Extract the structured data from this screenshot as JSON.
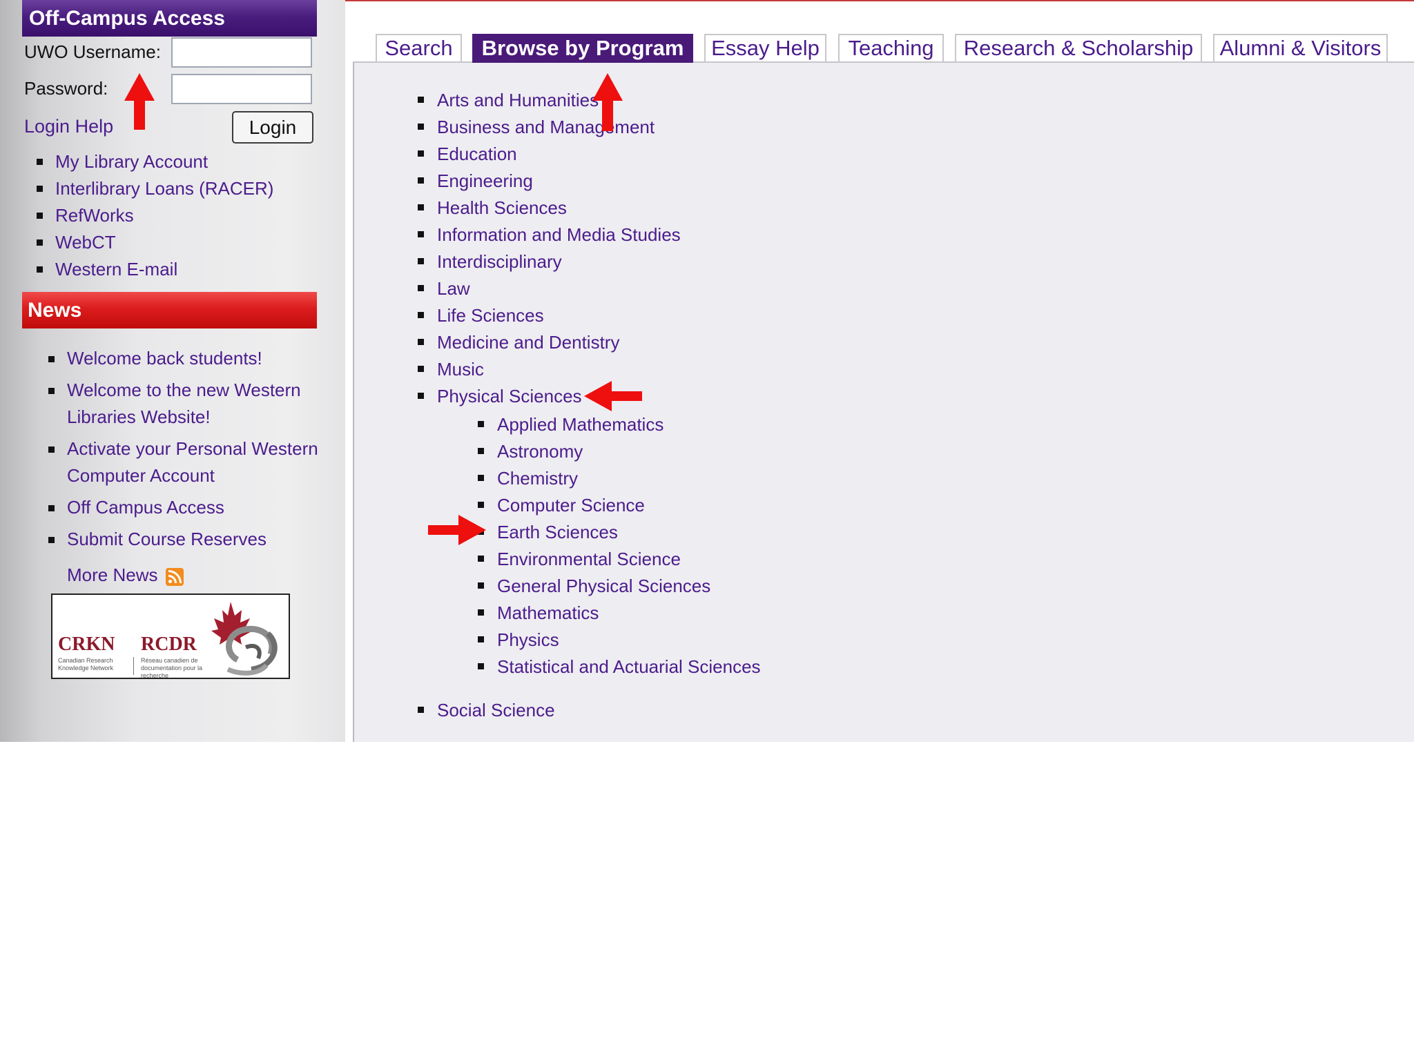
{
  "login": {
    "header": "Off-Campus Access",
    "username_label": "UWO Username:",
    "username_value": "",
    "password_label": "Password:",
    "password_value": "",
    "help_link": "Login Help",
    "login_button": "Login"
  },
  "account_links": [
    {
      "label": "My Library Account"
    },
    {
      "label": "Interlibrary Loans (RACER)"
    },
    {
      "label": "RefWorks"
    },
    {
      "label": "WebCT"
    },
    {
      "label": "Western E-mail"
    }
  ],
  "news": {
    "header": "News",
    "items": [
      {
        "label": "Welcome back students!"
      },
      {
        "label": "Welcome to the new Western Libraries Website!"
      },
      {
        "label": "Activate your Personal Western Computer Account"
      },
      {
        "label": "Off Campus Access"
      },
      {
        "label": "Submit Course Reserves"
      }
    ],
    "more_link": "More News",
    "more_icon": "rss-feed-icon"
  },
  "partner_logo": {
    "left_name": "CRKN",
    "left_sub": "Canadian Research Knowledge Network",
    "right_name": "RCDR",
    "right_sub": "Réseau canadien de documentation pour la recherche"
  },
  "tabs": [
    {
      "label": "Search",
      "active": false
    },
    {
      "label": "Browse by Program",
      "active": true
    },
    {
      "label": "Essay Help",
      "active": false
    },
    {
      "label": "Teaching",
      "active": false
    },
    {
      "label": "Research & Scholarship",
      "active": false
    },
    {
      "label": "Alumni & Visitors",
      "active": false
    }
  ],
  "programs": [
    {
      "label": "Arts and Humanities"
    },
    {
      "label": "Business and Management"
    },
    {
      "label": "Education"
    },
    {
      "label": "Engineering"
    },
    {
      "label": "Health Sciences"
    },
    {
      "label": "Information and Media Studies"
    },
    {
      "label": "Interdisciplinary"
    },
    {
      "label": "Law"
    },
    {
      "label": "Life Sciences"
    },
    {
      "label": "Medicine and Dentistry"
    },
    {
      "label": "Music"
    },
    {
      "label": "Physical Sciences"
    }
  ],
  "physical_sciences_subprograms": [
    {
      "label": "Applied Mathematics"
    },
    {
      "label": "Astronomy"
    },
    {
      "label": "Chemistry"
    },
    {
      "label": "Computer Science"
    },
    {
      "label": "Earth Sciences"
    },
    {
      "label": "Environmental Science"
    },
    {
      "label": "General Physical Sciences"
    },
    {
      "label": "Mathematics"
    },
    {
      "label": "Physics"
    },
    {
      "label": "Statistical and Actuarial Sciences"
    }
  ],
  "last_program": {
    "label": "Social Science"
  },
  "colors": {
    "link": "#4b1c8c",
    "login_header": "#4a1e7e",
    "news_header": "#dc1c1c",
    "active_tab": "#4a1a78",
    "annotation_arrow": "#ee0f0f"
  }
}
